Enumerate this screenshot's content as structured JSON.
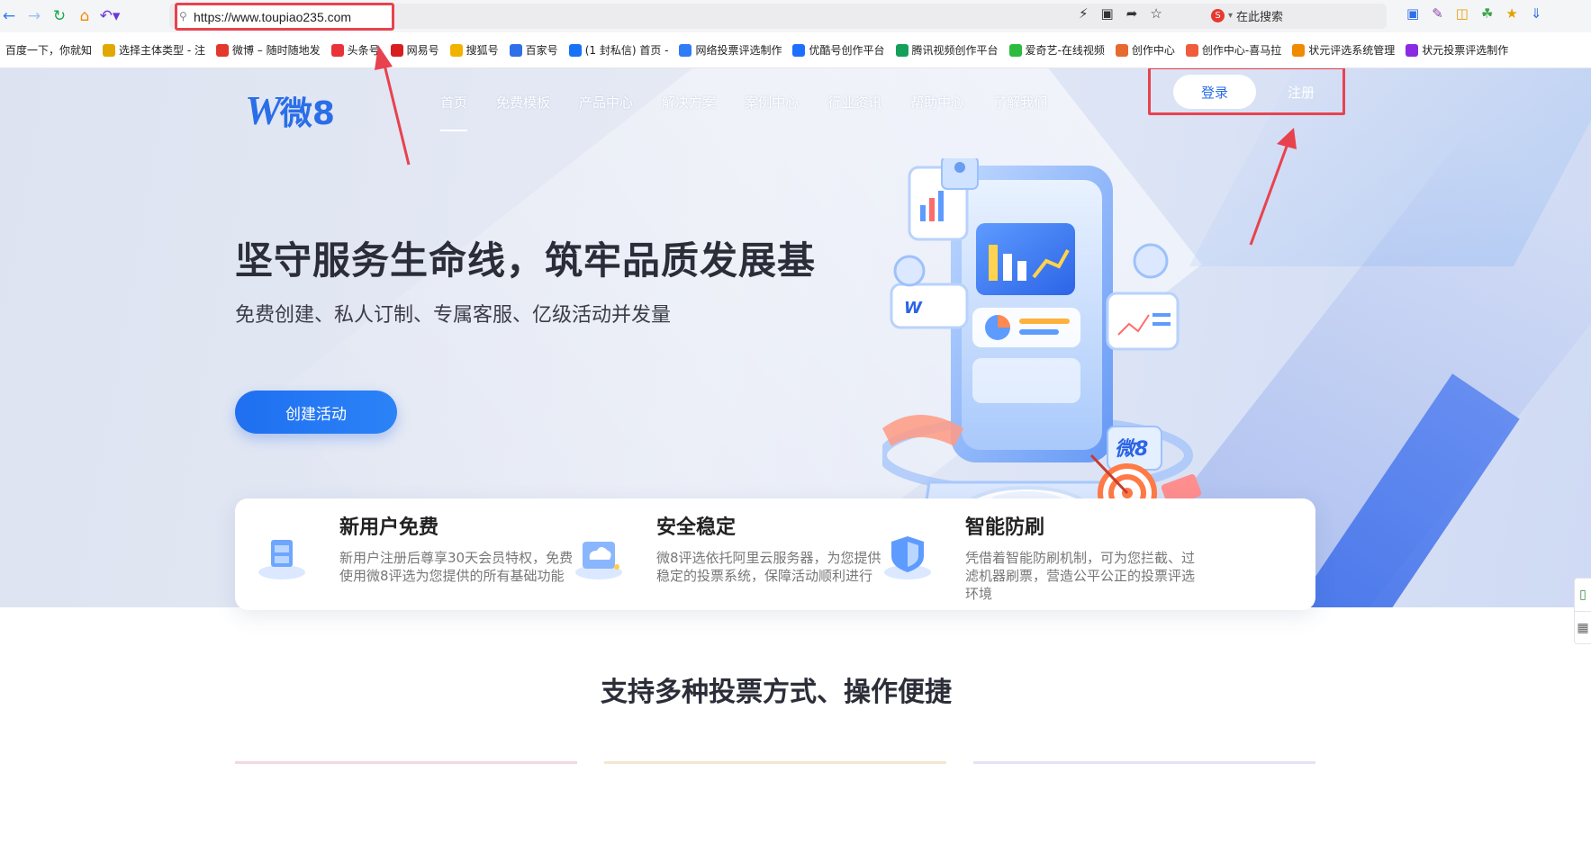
{
  "browser": {
    "url": "https://www.toupiao235.com",
    "search_label": "在此搜索",
    "bookmarks": [
      {
        "label": "百度一下，你就知",
        "color": "#2f6fe8"
      },
      {
        "label": "选择主体类型 - 注",
        "color": "#e0a800"
      },
      {
        "label": "微博 – 随时随地发",
        "color": "#e2382d"
      },
      {
        "label": "头条号",
        "color": "#e8333a"
      },
      {
        "label": "网易号",
        "color": "#d81e1e"
      },
      {
        "label": "搜狐号",
        "color": "#f2b300"
      },
      {
        "label": "百家号",
        "color": "#2f6fe8"
      },
      {
        "label": "(1 封私信) 首页 -",
        "color": "#1772f6"
      },
      {
        "label": "网络投票评选制作",
        "color": "#2f7cf6"
      },
      {
        "label": "优酷号创作平台",
        "color": "#1e6fff"
      },
      {
        "label": "腾讯视频创作平台",
        "color": "#14a05a"
      },
      {
        "label": "爱奇艺-在线视频",
        "color": "#2cbb3f"
      },
      {
        "label": "创作中心",
        "color": "#e56a2f"
      },
      {
        "label": "创作中心-喜马拉",
        "color": "#f05c3b"
      },
      {
        "label": "状元评选系统管理",
        "color": "#f08a00"
      },
      {
        "label": "状元投票评选制作",
        "color": "#8a2be2"
      }
    ]
  },
  "site": {
    "logo_text": "微8",
    "nav": [
      {
        "label": "首页",
        "active": true
      },
      {
        "label": "免费模板",
        "active": false
      },
      {
        "label": "产品中心",
        "active": false
      },
      {
        "label": "解决方案",
        "active": false
      },
      {
        "label": "案例中心",
        "active": false
      },
      {
        "label": "行业资讯",
        "active": false
      },
      {
        "label": "帮助中心",
        "active": false
      },
      {
        "label": "了解我们",
        "active": false
      }
    ],
    "login_label": "登录",
    "register_label": "注册",
    "hero": {
      "title": "坚守服务生命线，筑牢品质发展基",
      "subtitle": "免费创建、私人订制、专属客服、亿级活动并发量",
      "cta": "创建活动",
      "illustration_badge": "微8"
    },
    "features": [
      {
        "title": "新用户免费",
        "desc": "新用户注册后尊享30天会员特权，免费使用微8评选为您提供的所有基础功能",
        "icon": "cube-stack-icon"
      },
      {
        "title": "安全稳定",
        "desc": "微8评选依托阿里云服务器，为您提供稳定的投票系统，保障活动顺利进行",
        "icon": "cloud-server-icon"
      },
      {
        "title": "智能防刷",
        "desc": "凭借着智能防刷机制，可为您拦截、过滤机器刷票，营造公平公正的投票评选环境",
        "icon": "shield-icon"
      }
    ],
    "section_title": "支持多种投票方式、操作便捷"
  },
  "colors": {
    "brand": "#2a6ee8",
    "annotation": "#e8424f"
  }
}
